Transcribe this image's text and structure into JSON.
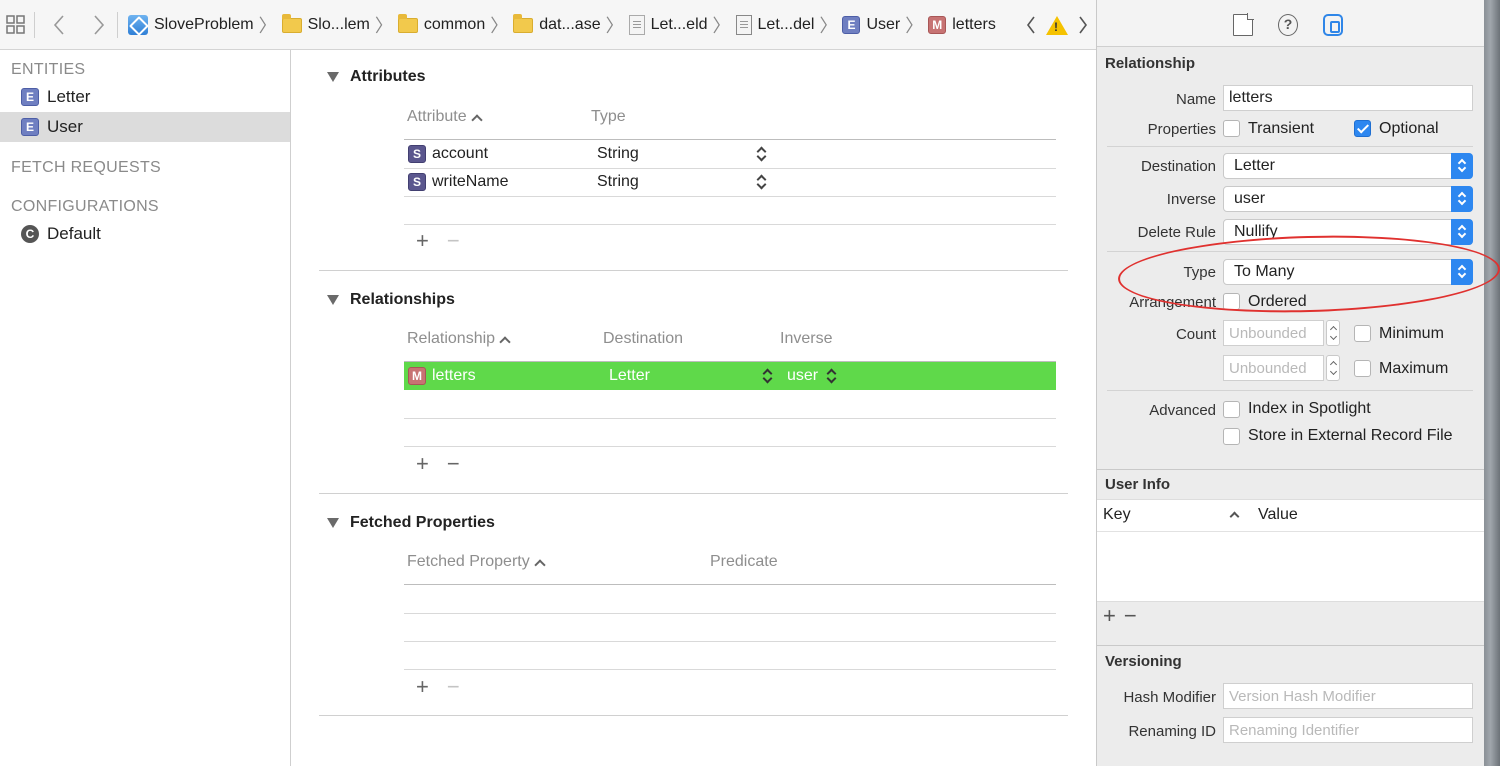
{
  "breadcrumbs": [
    {
      "label": "SloveProblem",
      "icon": "project-icon"
    },
    {
      "label": "Slo...lem",
      "icon": "folder-icon"
    },
    {
      "label": "common",
      "icon": "folder-icon"
    },
    {
      "label": "dat...ase",
      "icon": "folder-icon"
    },
    {
      "label": "Let...eld",
      "icon": "document-icon"
    },
    {
      "label": "Let...del",
      "icon": "datamodel-icon"
    },
    {
      "label": "User",
      "icon": "entity-icon",
      "badge": "E"
    },
    {
      "label": "letters",
      "icon": "relationship-icon",
      "badge": "M"
    }
  ],
  "sidebar": {
    "entities_header": "ENTITIES",
    "entities": [
      {
        "badge": "E",
        "label": "Letter",
        "selected": false
      },
      {
        "badge": "E",
        "label": "User",
        "selected": true
      }
    ],
    "fetch_requests_header": "FETCH REQUESTS",
    "configurations_header": "CONFIGURATIONS",
    "configurations": [
      {
        "badge": "C",
        "label": "Default"
      }
    ]
  },
  "editor": {
    "attributes": {
      "title": "Attributes",
      "col_attribute": "Attribute",
      "col_type": "Type",
      "rows": [
        {
          "badge": "S",
          "name": "account",
          "type": "String"
        },
        {
          "badge": "S",
          "name": "writeName",
          "type": "String"
        }
      ],
      "add": "+",
      "remove": "−"
    },
    "relationships": {
      "title": "Relationships",
      "col_relationship": "Relationship",
      "col_destination": "Destination",
      "col_inverse": "Inverse",
      "rows": [
        {
          "badge": "M",
          "name": "letters",
          "destination": "Letter",
          "inverse": "user",
          "selected": true
        }
      ],
      "add": "+",
      "remove": "−"
    },
    "fetched": {
      "title": "Fetched Properties",
      "col_fetched": "Fetched Property",
      "col_predicate": "Predicate",
      "add": "+",
      "remove": "−"
    }
  },
  "inspector": {
    "relationship_header": "Relationship",
    "name_label": "Name",
    "name_value": "letters",
    "properties_label": "Properties",
    "transient_label": "Transient",
    "transient_checked": false,
    "optional_label": "Optional",
    "optional_checked": true,
    "destination_label": "Destination",
    "destination_value": "Letter",
    "inverse_label": "Inverse",
    "inverse_value": "user",
    "delete_rule_label": "Delete Rule",
    "delete_rule_value": "Nullify",
    "type_label": "Type",
    "type_value": "To Many",
    "arrangement_label": "Arrangement",
    "ordered_label": "Ordered",
    "count_label": "Count",
    "min_placeholder": "Unbounded",
    "minimum_label": "Minimum",
    "max_placeholder": "Unbounded",
    "maximum_label": "Maximum",
    "advanced_label": "Advanced",
    "spotlight_label": "Index in Spotlight",
    "external_label": "Store in External Record File",
    "userinfo_header": "User Info",
    "key_col": "Key",
    "value_col": "Value",
    "userinfo_add": "+",
    "userinfo_remove": "−",
    "versioning_header": "Versioning",
    "hash_label": "Hash Modifier",
    "hash_placeholder": "Version Hash Modifier",
    "renaming_label": "Renaming ID",
    "renaming_placeholder": "Renaming Identifier",
    "help_glyph": "?"
  },
  "colors": {
    "selected_row": "#5fd94a",
    "accent": "#2d87f0",
    "annotation": "#e0312f"
  }
}
